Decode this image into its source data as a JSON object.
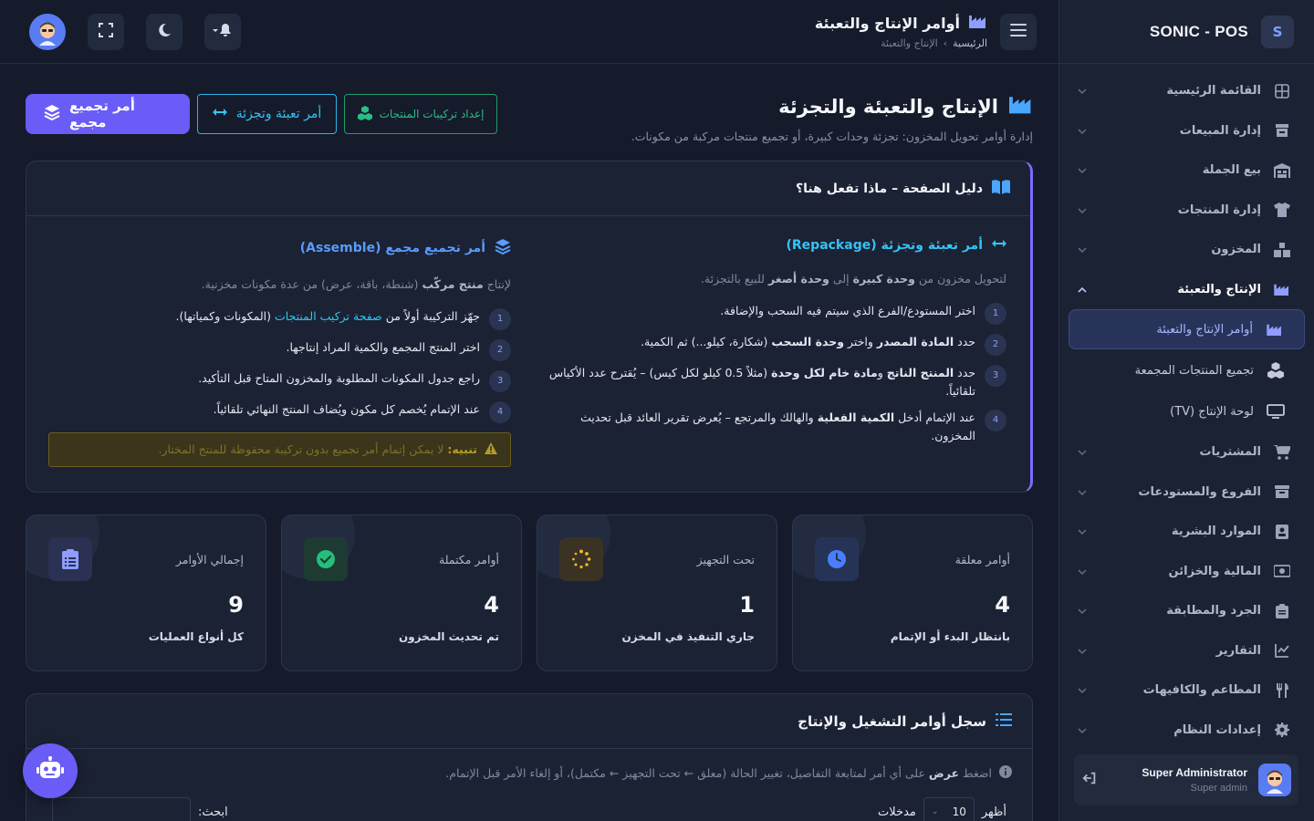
{
  "brand": {
    "name": "SONIC - POS",
    "logo_letter": "S"
  },
  "sidebar": {
    "items": [
      {
        "label": "القائمة الرئيسية",
        "icon": "dashboard-icon"
      },
      {
        "label": "إدارة المبيعات",
        "icon": "store-icon"
      },
      {
        "label": "بيع الجملة",
        "icon": "warehouse-icon"
      },
      {
        "label": "إدارة المنتجات",
        "icon": "shirt-icon"
      },
      {
        "label": "المخزون",
        "icon": "boxes-icon"
      },
      {
        "label": "الإنتاج والتعبئة",
        "icon": "industry-icon",
        "open": true
      },
      {
        "label": "المشتريات",
        "icon": "cart-icon"
      },
      {
        "label": "الفروع والمستودعات",
        "icon": "archive-icon"
      },
      {
        "label": "الموارد البشرية",
        "icon": "id-badge-icon"
      },
      {
        "label": "المالية والخزائن",
        "icon": "money-icon"
      },
      {
        "label": "الجرد والمطابقة",
        "icon": "clipboard-icon"
      },
      {
        "label": "التقارير",
        "icon": "chart-line-icon"
      },
      {
        "label": "المطاعم والكافيهات",
        "icon": "utensils-icon"
      },
      {
        "label": "إعدادات النظام",
        "icon": "gear-icon"
      }
    ],
    "sub_items": [
      {
        "label": "أوامر الإنتاج والتعبئة",
        "icon": "industry-icon",
        "active": true
      },
      {
        "label": "تجميع المنتجات المجمعة",
        "icon": "cubes-icon"
      },
      {
        "label": "لوحة الإنتاج (TV)",
        "icon": "tv-icon"
      }
    ],
    "user": {
      "name": "Super Administrator",
      "role": "Super admin"
    }
  },
  "header": {
    "title": "أوامر الإنتاج والتعبئة",
    "breadcrumb": {
      "home": "الرئيسية",
      "separator": "›",
      "current": "الإنتاج والتعبئة"
    }
  },
  "page": {
    "title": "الإنتاج والتعبئة والتجزئة",
    "subtitle": "إدارة أوامر تحويل المخزون: تجزئة وحدات كبيرة، أو تجميع منتجات مركبة من مكونات.",
    "buttons": {
      "setup": "إعداد تركيبات المنتجات",
      "repack": "أمر تعبئة وتجزئة",
      "assemble": "أمر تجميع مجمع"
    }
  },
  "guide": {
    "title": "دليل الصفحة – ماذا تفعل هنا؟",
    "repack": {
      "title": "أمر تعبئة وتجزئة (Repackage)",
      "sub_a": "لتحويل مخزون من ",
      "sub_b": "وحدة كبيرة",
      "sub_c": " إلى ",
      "sub_d": "وحدة أصغر",
      "sub_e": " للبيع بالتجزئة.",
      "steps": [
        {
          "n": "1",
          "a": "اختر المستودع/الفرع الذي سيتم فيه السحب والإضافة.",
          "b": "",
          "c": "",
          "d": "",
          "e": ""
        },
        {
          "n": "2",
          "a": "حدد ",
          "b": "المادة المصدر",
          "c": " واختر ",
          "d": "وحدة السحب",
          "e": " (شكارة، كيلو...) ثم الكمية."
        },
        {
          "n": "3",
          "a": "حدد ",
          "b": "المنتج الناتج",
          "c": " و",
          "d": "مادة خام لكل وحدة",
          "e": " (مثلاً 0.5 كيلو لكل كيس) – يُقترح عدد الأكياس تلقائياً."
        },
        {
          "n": "4",
          "a": "عند الإتمام أدخل ",
          "b": "الكمية الفعلية",
          "c": " والهالك والمرتجع – يُعرض تقرير العائد قبل تحديث المخزون.",
          "d": "",
          "e": ""
        }
      ]
    },
    "assemble": {
      "title": "أمر تجميع مجمع (Assemble)",
      "sub_a": "لإنتاج ",
      "sub_b": "منتج مركّب",
      "sub_c": " (شنطة، باقة، عرض) من عدة مكونات مخزنية.",
      "steps": [
        {
          "n": "1",
          "a": "جهّز التركيبة أولاً من ",
          "link": "صفحة تركيب المنتجات",
          "c": " (المكونات وكمياتها)."
        },
        {
          "n": "2",
          "a": "اختر المنتج المجمع والكمية المراد إنتاجها.",
          "link": "",
          "c": ""
        },
        {
          "n": "3",
          "a": "راجع جدول المكونات المطلوبة والمخزون المتاح قبل التأكيد.",
          "link": "",
          "c": ""
        },
        {
          "n": "4",
          "a": "عند الإتمام يُخصم كل مكون ويُضاف المنتج النهائي تلقائياً.",
          "link": "",
          "c": ""
        }
      ],
      "warning_label": "تنبيه:",
      "warning_text": " لا يمكن إتمام أمر تجميع بدون تركيبة محفوظة للمنتج المختار."
    }
  },
  "stats": [
    {
      "label": "أوامر معلقة",
      "value": "4",
      "desc": "بانتظار البدء أو الإتمام",
      "icon": "clock-icon",
      "color": "#4a7dff",
      "bg": "#253456"
    },
    {
      "label": "تحت التجهيز",
      "value": "1",
      "desc": "جاري التنفيذ في المخزن",
      "icon": "spinner-icon",
      "color": "#f2b632",
      "bg": "#3a3324"
    },
    {
      "label": "أوامر مكتملة",
      "value": "4",
      "desc": "تم تحديث المخزون",
      "icon": "check-circle-icon",
      "color": "#24c07a",
      "bg": "#1d3a33"
    },
    {
      "label": "إجمالي الأوامر",
      "value": "9",
      "desc": "كل أنواع العمليات",
      "icon": "clipboard-list-icon",
      "color": "#8e9dff",
      "bg": "#2a3152"
    }
  ],
  "log": {
    "title": "سجل أوامر التشغيل والإنتاج",
    "hint_a": "اضغط ",
    "hint_b": "عرض",
    "hint_c": " على أي أمر لمتابعة التفاصيل، تغيير الحالة (معلق ← تحت التجهيز ← مكتمل)، أو إلغاء الأمر قبل الإتمام.",
    "show_label": "أظهر",
    "show_value": "10",
    "entries_label": "مدخلات",
    "search_label": "ابحث:"
  }
}
